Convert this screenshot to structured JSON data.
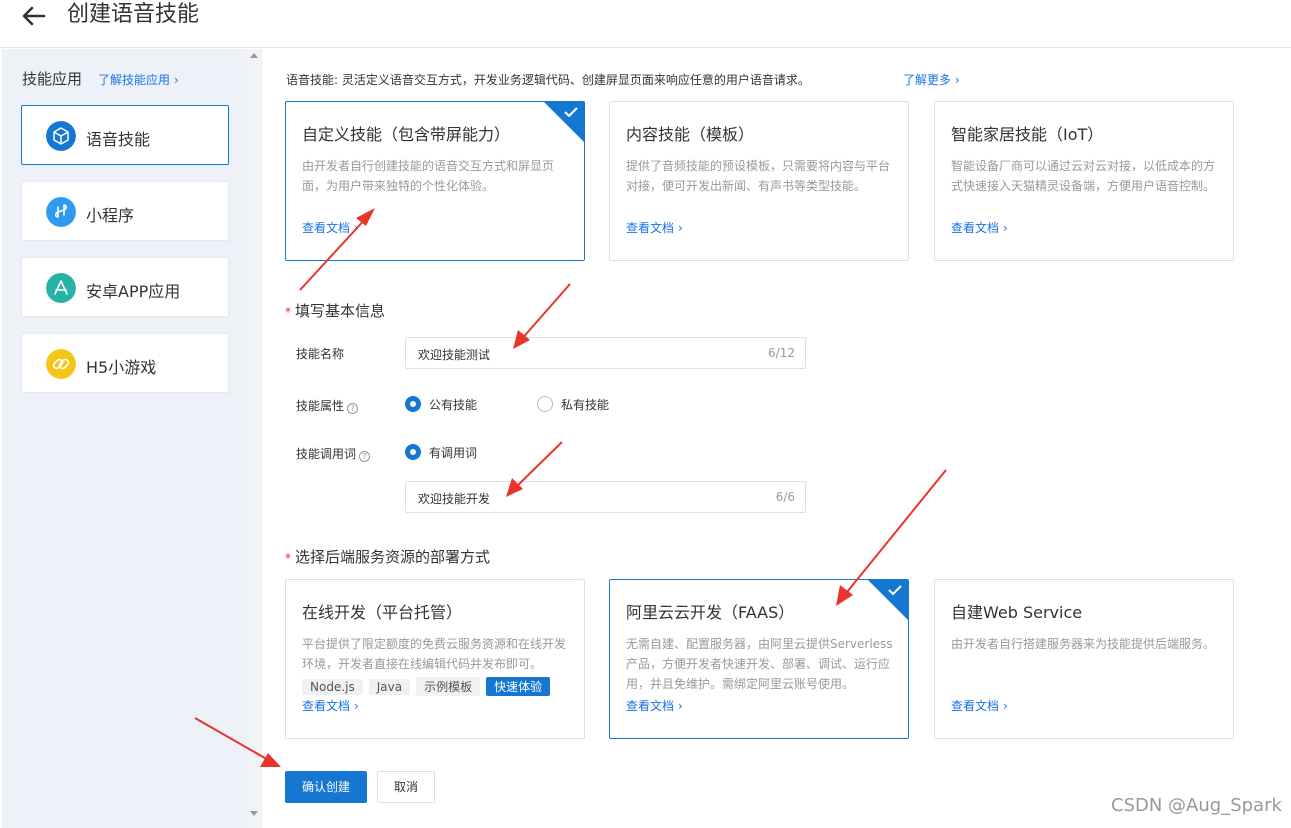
{
  "header": {
    "title": "创建语音技能"
  },
  "sidebar": {
    "heading": "技能应用",
    "learn_link": "了解技能应用",
    "items": [
      {
        "label": "语音技能",
        "icon": "cube-icon",
        "color": "#1677d2"
      },
      {
        "label": "小程序",
        "icon": "mini-program-icon",
        "color": "#2f9bf0"
      },
      {
        "label": "安卓APP应用",
        "icon": "app-store-icon",
        "color": "#24b3a5"
      },
      {
        "label": "H5小游戏",
        "icon": "link-icon",
        "color": "#f5c518"
      }
    ]
  },
  "intro": {
    "text": "语音技能: 灵活定义语音交互方式，开发业务逻辑代码、创建屏显页面来响应任意的用户语音请求。",
    "more": "了解更多"
  },
  "skill_types": [
    {
      "title": "自定义技能（包含带屏能力）",
      "desc": "由开发者自行创建技能的语音交互方式和屏显页面，为用户带来独特的个性化体验。",
      "doc": "查看文档"
    },
    {
      "title": "内容技能（模板）",
      "desc": "提供了音频技能的预设模板，只需要将内容与平台对接，便可开发出新闻、有声书等类型技能。",
      "doc": "查看文档"
    },
    {
      "title": "智能家居技能（IoT）",
      "desc": "智能设备厂商可以通过云对云对接，以低成本的方式快速接入天猫精灵设备端，方便用户语音控制。",
      "doc": "查看文档"
    }
  ],
  "basic_info": {
    "section_title": "填写基本信息",
    "required_mark": "*",
    "name_label": "技能名称",
    "name_value": "欢迎技能测试",
    "name_count": "6/12",
    "attr_label": "技能属性",
    "attr_options": [
      "公有技能",
      "私有技能"
    ],
    "invoke_label": "技能调用词",
    "invoke_option": "有调用词",
    "invoke_value": "欢迎技能开发",
    "invoke_count": "6/6",
    "help": "?"
  },
  "deploy": {
    "section_title": "选择后端服务资源的部署方式",
    "required_mark": "*",
    "options": [
      {
        "title": "在线开发（平台托管）",
        "desc": "平台提供了限定额度的免费云服务资源和在线开发环境，开发者直接在线编辑代码并发布即可。",
        "doc": "查看文档",
        "tags": [
          "Node.js",
          "Java",
          "示例模板",
          "快速体验"
        ]
      },
      {
        "title": "阿里云云开发（FAAS）",
        "desc": "无需自建、配置服务器，由阿里云提供Serverless产品，方便开发者快速开发、部署、调试、运行应用，并且免维护。需绑定阿里云账号使用。",
        "doc": "查看文档"
      },
      {
        "title": "自建Web Service",
        "desc": "由开发者自行搭建服务器来为技能提供后端服务。",
        "doc": "查看文档"
      }
    ]
  },
  "actions": {
    "confirm": "确认创建",
    "cancel": "取消"
  },
  "watermark": "CSDN @Aug_Spark",
  "colors": {
    "primary": "#1677d2",
    "annotation_arrow": "#e8342b"
  }
}
